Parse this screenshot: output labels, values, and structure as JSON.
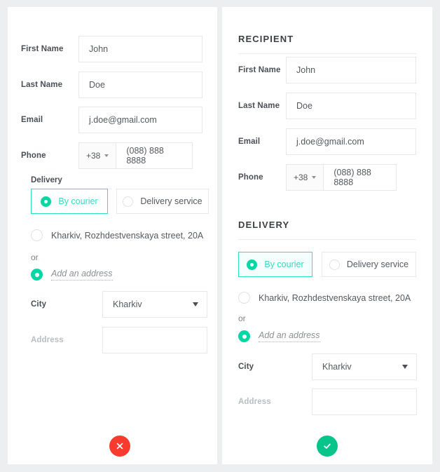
{
  "theme": {
    "page_background": "#eceef0",
    "panel_background": "#ffffff",
    "accent_teal": "#06d6a4",
    "accent_teal_border": "#2de0c2",
    "cancel_red": "#f93a2f",
    "confirm_green": "#06c48a",
    "label_color": "#4a4f55",
    "value_color": "#55595f",
    "muted_color": "#b9bcc1",
    "border_color": "#e6e8ea"
  },
  "left_panel": {
    "fields": {
      "first_name": {
        "label": "First Name",
        "value": "John"
      },
      "last_name": {
        "label": "Last Name",
        "value": "Doe"
      },
      "email": {
        "label": "Email",
        "value": "j.doe@gmail.com"
      },
      "phone": {
        "label": "Phone",
        "prefix": "+38",
        "value": "(088) 888 8888"
      }
    },
    "delivery": {
      "label": "Delivery",
      "options": [
        {
          "label": "By courier",
          "selected": true
        },
        {
          "label": "Delivery service",
          "selected": false
        }
      ],
      "saved_address": {
        "label": "Kharkiv, Rozhdestvenskaya street, 20A",
        "selected": false
      },
      "or_label": "or",
      "add_address": {
        "label": "Add an address",
        "selected": true
      },
      "city": {
        "label": "City",
        "value": "Kharkiv"
      },
      "address": {
        "label": "Address",
        "value": ""
      }
    },
    "action": {
      "name": "cancel",
      "icon": "close-icon"
    }
  },
  "right_panel": {
    "recipient_title": "RECIPIENT",
    "fields": {
      "first_name": {
        "label": "First Name",
        "value": "John"
      },
      "last_name": {
        "label": "Last Name",
        "value": "Doe"
      },
      "email": {
        "label": "Email",
        "value": "j.doe@gmail.com"
      },
      "phone": {
        "label": "Phone",
        "prefix": "+38",
        "value": "(088) 888 8888"
      }
    },
    "delivery": {
      "title": "DELIVERY",
      "options": [
        {
          "label": "By courier",
          "selected": true
        },
        {
          "label": "Delivery service",
          "selected": false
        }
      ],
      "saved_address": {
        "label": "Kharkiv, Rozhdestvenskaya street, 20A",
        "selected": false
      },
      "or_label": "or",
      "add_address": {
        "label": "Add an address",
        "selected": true
      },
      "city": {
        "label": "City",
        "value": "Kharkiv"
      },
      "address": {
        "label": "Address",
        "value": ""
      }
    },
    "action": {
      "name": "confirm",
      "icon": "check-icon"
    }
  }
}
